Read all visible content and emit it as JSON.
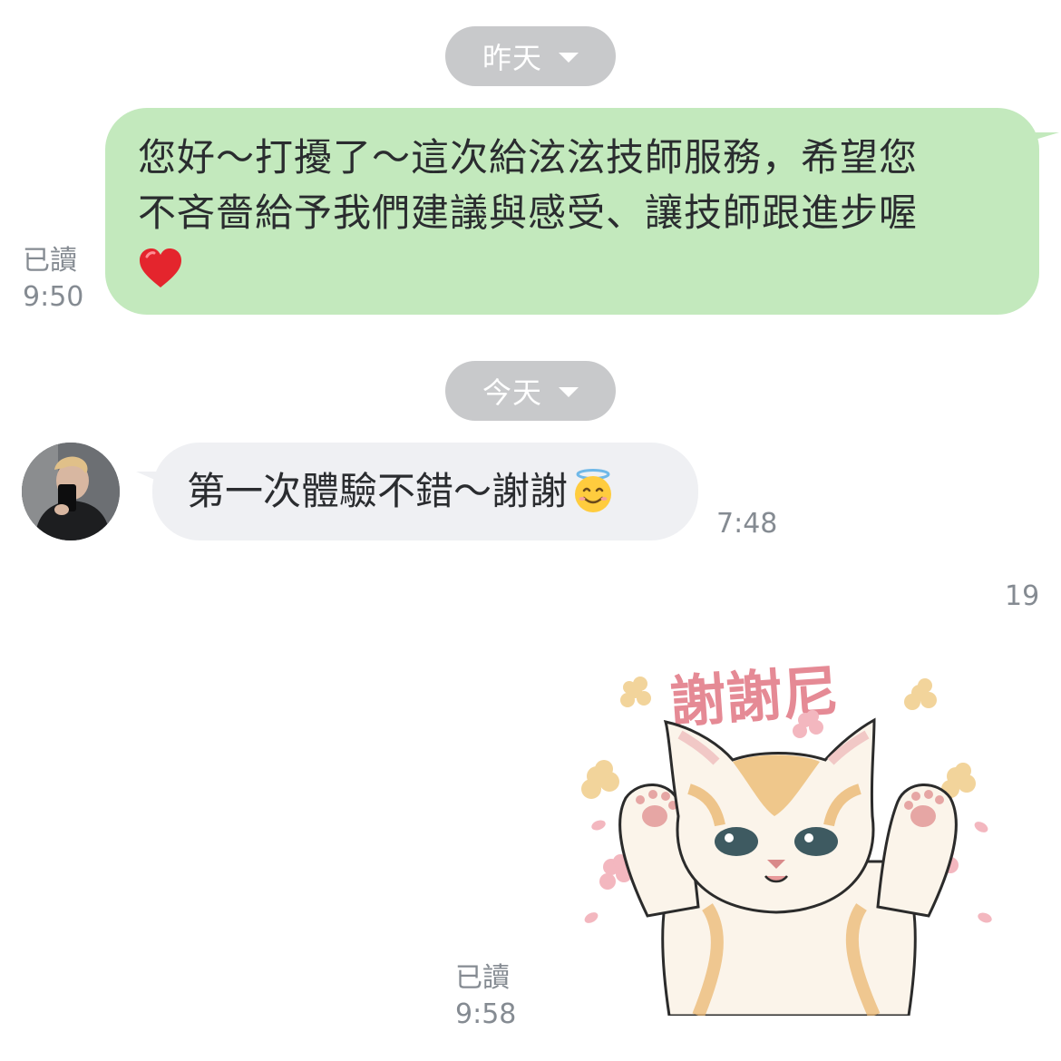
{
  "dividers": {
    "yesterday": "昨天",
    "today": "今天"
  },
  "messages": {
    "outgoing_1": {
      "line1": "您好～打擾了～這次給泫泫技師服務，希望您",
      "line2": "不吝嗇給予我們建議與感受、讓技師跟進步喔",
      "emoji": "red-heart",
      "read_label": "已讀",
      "time": "9:50"
    },
    "incoming_1": {
      "text": "第一次體驗不錯～謝謝",
      "emoji": "smiling-face-with-halo",
      "time": "7:48"
    },
    "unread_count": "19",
    "sticker": {
      "caption": "謝謝尼",
      "read_label": "已讀",
      "time": "9:58"
    }
  },
  "colors": {
    "outgoing_bubble": "#c3e9bd",
    "incoming_bubble": "#eff0f3",
    "date_pill": "#c8c9cb",
    "meta_text": "#858b92",
    "sticker_text": "#e58a95"
  }
}
